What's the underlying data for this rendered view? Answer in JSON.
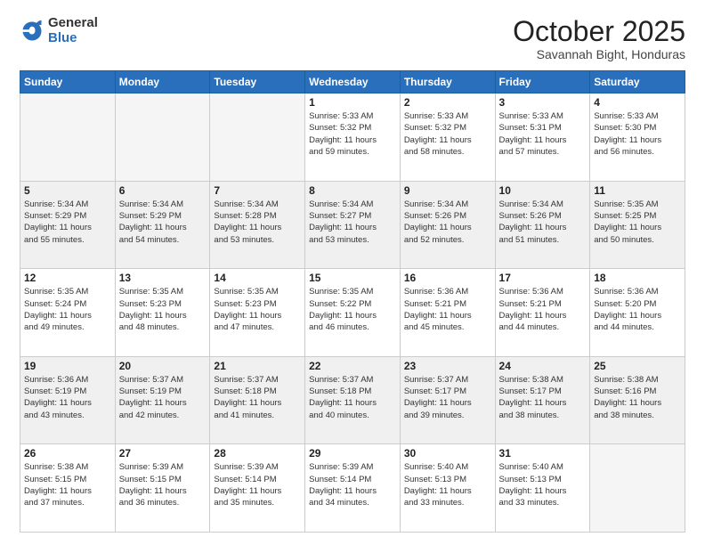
{
  "logo": {
    "general": "General",
    "blue": "Blue"
  },
  "title": "October 2025",
  "subtitle": "Savannah Bight, Honduras",
  "days_header": [
    "Sunday",
    "Monday",
    "Tuesday",
    "Wednesday",
    "Thursday",
    "Friday",
    "Saturday"
  ],
  "weeks": [
    {
      "shaded": false,
      "days": [
        {
          "num": "",
          "info": ""
        },
        {
          "num": "",
          "info": ""
        },
        {
          "num": "",
          "info": ""
        },
        {
          "num": "1",
          "info": "Sunrise: 5:33 AM\nSunset: 5:32 PM\nDaylight: 11 hours\nand 59 minutes."
        },
        {
          "num": "2",
          "info": "Sunrise: 5:33 AM\nSunset: 5:32 PM\nDaylight: 11 hours\nand 58 minutes."
        },
        {
          "num": "3",
          "info": "Sunrise: 5:33 AM\nSunset: 5:31 PM\nDaylight: 11 hours\nand 57 minutes."
        },
        {
          "num": "4",
          "info": "Sunrise: 5:33 AM\nSunset: 5:30 PM\nDaylight: 11 hours\nand 56 minutes."
        }
      ]
    },
    {
      "shaded": true,
      "days": [
        {
          "num": "5",
          "info": "Sunrise: 5:34 AM\nSunset: 5:29 PM\nDaylight: 11 hours\nand 55 minutes."
        },
        {
          "num": "6",
          "info": "Sunrise: 5:34 AM\nSunset: 5:29 PM\nDaylight: 11 hours\nand 54 minutes."
        },
        {
          "num": "7",
          "info": "Sunrise: 5:34 AM\nSunset: 5:28 PM\nDaylight: 11 hours\nand 53 minutes."
        },
        {
          "num": "8",
          "info": "Sunrise: 5:34 AM\nSunset: 5:27 PM\nDaylight: 11 hours\nand 53 minutes."
        },
        {
          "num": "9",
          "info": "Sunrise: 5:34 AM\nSunset: 5:26 PM\nDaylight: 11 hours\nand 52 minutes."
        },
        {
          "num": "10",
          "info": "Sunrise: 5:34 AM\nSunset: 5:26 PM\nDaylight: 11 hours\nand 51 minutes."
        },
        {
          "num": "11",
          "info": "Sunrise: 5:35 AM\nSunset: 5:25 PM\nDaylight: 11 hours\nand 50 minutes."
        }
      ]
    },
    {
      "shaded": false,
      "days": [
        {
          "num": "12",
          "info": "Sunrise: 5:35 AM\nSunset: 5:24 PM\nDaylight: 11 hours\nand 49 minutes."
        },
        {
          "num": "13",
          "info": "Sunrise: 5:35 AM\nSunset: 5:23 PM\nDaylight: 11 hours\nand 48 minutes."
        },
        {
          "num": "14",
          "info": "Sunrise: 5:35 AM\nSunset: 5:23 PM\nDaylight: 11 hours\nand 47 minutes."
        },
        {
          "num": "15",
          "info": "Sunrise: 5:35 AM\nSunset: 5:22 PM\nDaylight: 11 hours\nand 46 minutes."
        },
        {
          "num": "16",
          "info": "Sunrise: 5:36 AM\nSunset: 5:21 PM\nDaylight: 11 hours\nand 45 minutes."
        },
        {
          "num": "17",
          "info": "Sunrise: 5:36 AM\nSunset: 5:21 PM\nDaylight: 11 hours\nand 44 minutes."
        },
        {
          "num": "18",
          "info": "Sunrise: 5:36 AM\nSunset: 5:20 PM\nDaylight: 11 hours\nand 44 minutes."
        }
      ]
    },
    {
      "shaded": true,
      "days": [
        {
          "num": "19",
          "info": "Sunrise: 5:36 AM\nSunset: 5:19 PM\nDaylight: 11 hours\nand 43 minutes."
        },
        {
          "num": "20",
          "info": "Sunrise: 5:37 AM\nSunset: 5:19 PM\nDaylight: 11 hours\nand 42 minutes."
        },
        {
          "num": "21",
          "info": "Sunrise: 5:37 AM\nSunset: 5:18 PM\nDaylight: 11 hours\nand 41 minutes."
        },
        {
          "num": "22",
          "info": "Sunrise: 5:37 AM\nSunset: 5:18 PM\nDaylight: 11 hours\nand 40 minutes."
        },
        {
          "num": "23",
          "info": "Sunrise: 5:37 AM\nSunset: 5:17 PM\nDaylight: 11 hours\nand 39 minutes."
        },
        {
          "num": "24",
          "info": "Sunrise: 5:38 AM\nSunset: 5:17 PM\nDaylight: 11 hours\nand 38 minutes."
        },
        {
          "num": "25",
          "info": "Sunrise: 5:38 AM\nSunset: 5:16 PM\nDaylight: 11 hours\nand 38 minutes."
        }
      ]
    },
    {
      "shaded": false,
      "days": [
        {
          "num": "26",
          "info": "Sunrise: 5:38 AM\nSunset: 5:15 PM\nDaylight: 11 hours\nand 37 minutes."
        },
        {
          "num": "27",
          "info": "Sunrise: 5:39 AM\nSunset: 5:15 PM\nDaylight: 11 hours\nand 36 minutes."
        },
        {
          "num": "28",
          "info": "Sunrise: 5:39 AM\nSunset: 5:14 PM\nDaylight: 11 hours\nand 35 minutes."
        },
        {
          "num": "29",
          "info": "Sunrise: 5:39 AM\nSunset: 5:14 PM\nDaylight: 11 hours\nand 34 minutes."
        },
        {
          "num": "30",
          "info": "Sunrise: 5:40 AM\nSunset: 5:13 PM\nDaylight: 11 hours\nand 33 minutes."
        },
        {
          "num": "31",
          "info": "Sunrise: 5:40 AM\nSunset: 5:13 PM\nDaylight: 11 hours\nand 33 minutes."
        },
        {
          "num": "",
          "info": ""
        }
      ]
    }
  ]
}
